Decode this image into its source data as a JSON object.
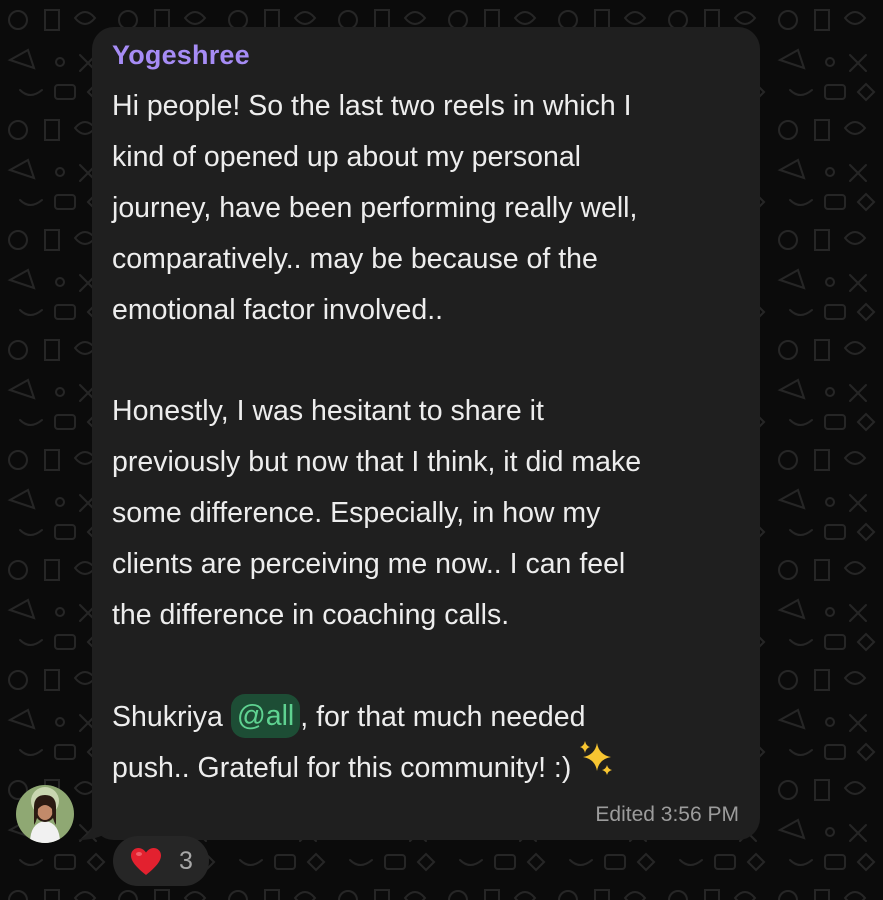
{
  "message": {
    "sender": "Yogeshree",
    "paragraphs": [
      [
        "Hi people! So the last two reels in which I",
        "kind of opened up about my personal",
        "journey, have been performing really well,",
        "comparatively.. may be because of the",
        "emotional factor involved.."
      ],
      [
        "Honestly, I was hesitant to share it",
        "previously but now that I think, it did make",
        "some difference. Especially, in how my",
        "clients are perceiving me now.. I can feel",
        "the difference in coaching calls."
      ]
    ],
    "closing": {
      "prefix": "Shukriya ",
      "mention": "@all",
      "suffix": ", for that much needed",
      "line2": "push.. Grateful for this community! :)",
      "emoji": "sparkles-emoji"
    },
    "edited_label": "Edited",
    "time": "3:56 PM"
  },
  "reactions": [
    {
      "emoji": "red-heart-emoji",
      "count": "3"
    }
  ],
  "colors": {
    "background": "#0b0b0b",
    "bubble": "#1f1f1f",
    "sender_name": "#a68cf5",
    "mention_bg": "#1d4d35",
    "mention_text": "#5fd291",
    "text": "#ededed",
    "meta": "#9c9c9c"
  }
}
